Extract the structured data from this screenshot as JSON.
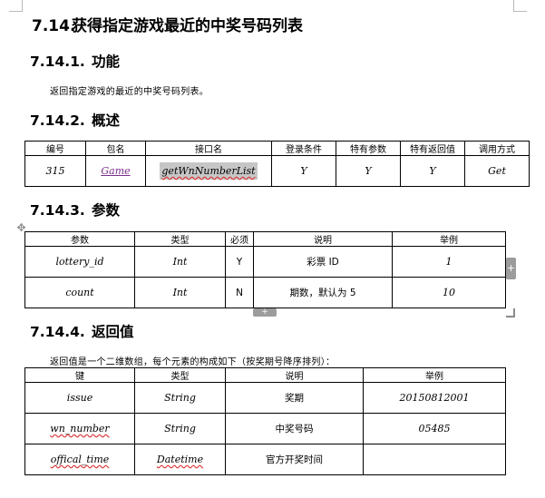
{
  "heading": {
    "num": "7.14.",
    "title": "获得指定游戏最近的中奖号码列表"
  },
  "s1": {
    "num": "7.14.1.",
    "title": "功能",
    "text": "返回指定游戏的最近的中奖号码列表。"
  },
  "s2": {
    "num": "7.14.2.",
    "title": "概述",
    "headers": [
      "编号",
      "包名",
      "接口名",
      "登录条件",
      "特有参数",
      "特有返回值",
      "调用方式"
    ],
    "row": {
      "id": "315",
      "package": "Game",
      "interface": "getWnNumberList",
      "login": "Y",
      "params": "Y",
      "returns": "Y",
      "method": "Get"
    }
  },
  "s3": {
    "num": "7.14.3.",
    "title": "参数",
    "headers": [
      "参数",
      "类型",
      "必须",
      "说明",
      "举例"
    ],
    "rows": [
      {
        "name": "lottery_id",
        "type": "Int",
        "required": "Y",
        "desc": "彩票 ID",
        "example": "1"
      },
      {
        "name": "count",
        "type": "Int",
        "required": "N",
        "desc": "期数，默认为 5",
        "example": "10"
      }
    ]
  },
  "s4": {
    "num": "7.14.4.",
    "title": "返回值",
    "text": "返回值是一个二维数组，每个元素的构成如下（按奖期号降序排列）：",
    "headers": [
      "键",
      "类型",
      "说明",
      "举例"
    ],
    "rows": [
      {
        "key": "issue",
        "type": "String",
        "desc": "奖期",
        "example": "20150812001"
      },
      {
        "key": "wn_number",
        "type": "String",
        "desc": "中奖号码",
        "example": "05485"
      },
      {
        "key": "offical_time",
        "type": "Datetime",
        "desc": "官方开奖时间",
        "example": ""
      }
    ]
  },
  "icons": [
    "table-move-icon",
    "add-column-icon",
    "add-row-icon",
    "table-resize-icon"
  ]
}
